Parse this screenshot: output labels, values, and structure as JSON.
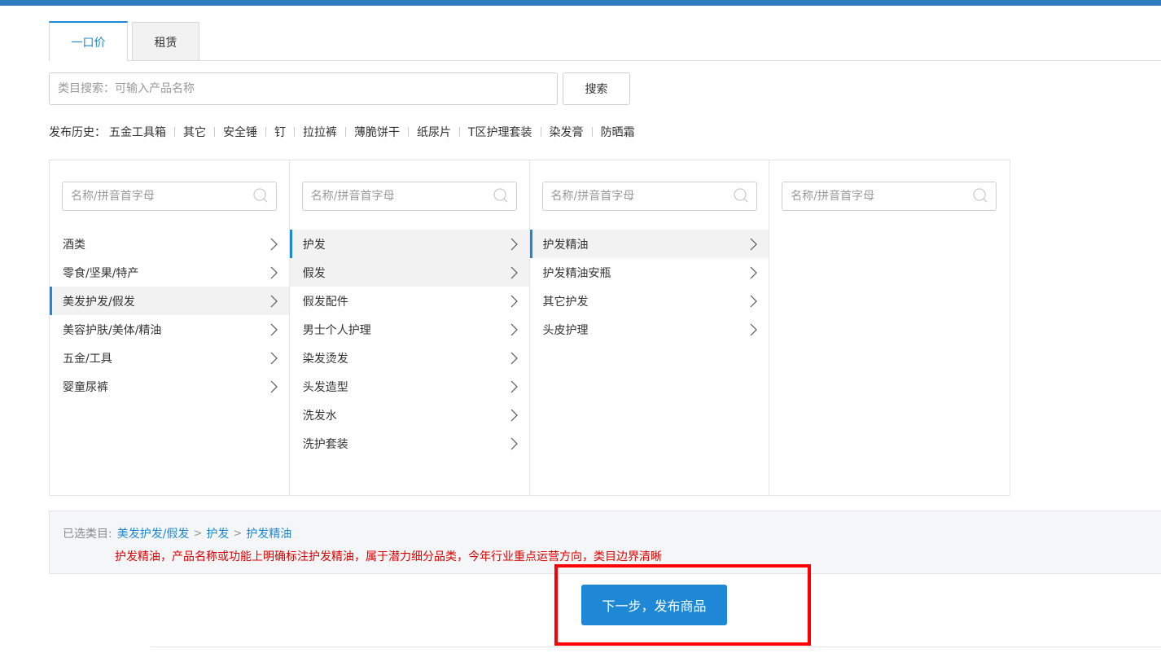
{
  "tabs": [
    {
      "label": "一口价"
    },
    {
      "label": "租赁"
    }
  ],
  "search": {
    "placeholder": "类目搜索：可输入产品名称",
    "button_label": "搜索"
  },
  "history": {
    "label": "发布历史：",
    "items": [
      "五金工具箱",
      "其它",
      "安全锤",
      "钉",
      "拉拉裤",
      "薄脆饼干",
      "纸尿片",
      "T区护理套装",
      "染发膏",
      "防晒霜"
    ]
  },
  "columns": [
    {
      "filter_placeholder": "名称/拼音首字母",
      "items": [
        "酒类",
        "零食/坚果/特产",
        "美发护发/假发",
        "美容护肤/美体/精油",
        "五金/工具",
        "婴童尿裤"
      ]
    },
    {
      "filter_placeholder": "名称/拼音首字母",
      "items": [
        "护发",
        "假发",
        "假发配件",
        "男士个人护理",
        "染发烫发",
        "头发造型",
        "洗发水",
        "洗护套装"
      ]
    },
    {
      "filter_placeholder": "名称/拼音首字母",
      "items": [
        "护发精油",
        "护发精油安瓶",
        "其它护发",
        "头皮护理"
      ]
    },
    {
      "filter_placeholder": "名称/拼音首字母",
      "items": []
    }
  ],
  "selected": {
    "prefix": "已选类目:",
    "path": [
      "美发护发/假发",
      "护发",
      "护发精油"
    ],
    "note": "护发精油，产品名称或功能上明确标注护发精油，属于潜力细分品类，今年行业重点运营方向，类目边界清晰"
  },
  "next_button_label": "下一步，发布商品",
  "colors": {
    "accent": "#1e88d6",
    "topbar": "#2e7dc1",
    "warning": "#e00000",
    "highlight_frame": "#ff0000"
  }
}
